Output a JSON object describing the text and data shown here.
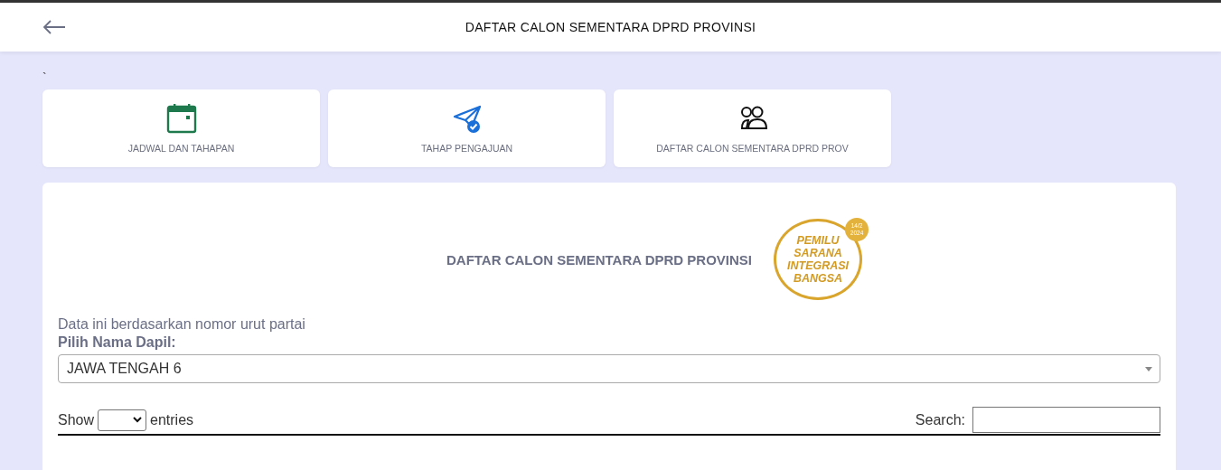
{
  "header": {
    "title": "DAFTAR CALON SEMENTARA DPRD PROVINSI"
  },
  "note": "`",
  "menu_cards": [
    {
      "kind": "calendar",
      "label": "JADWAL DAN TAHAPAN"
    },
    {
      "kind": "send",
      "label": "TAHAP PENGAJUAN"
    },
    {
      "kind": "people",
      "label": "DAFTAR CALON SEMENTARA DPRD PROV"
    }
  ],
  "panel": {
    "title": "DAFTAR CALON SEMENTARA DPRD PROVINSI",
    "logo": {
      "text": "PEMILU SARANA INTEGRASI BANGSA",
      "date": "14/2 2024"
    },
    "info": "Data ini berdasarkan nomor urut partai",
    "dapil_label": "Pilih Nama Dapil:",
    "dapil_value": "JAWA TENGAH 6",
    "show_label": "Show",
    "entries_label": "entries",
    "search_label": "Search:"
  }
}
